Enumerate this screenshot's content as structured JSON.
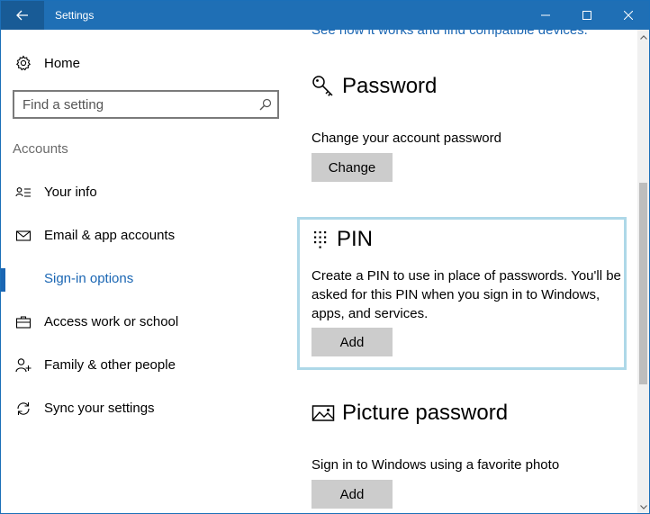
{
  "window": {
    "title": "Settings"
  },
  "sidebar": {
    "home_label": "Home",
    "search_placeholder": "Find a setting",
    "section_heading": "Accounts",
    "items": [
      {
        "label": "Your info",
        "icon": "person-card-icon"
      },
      {
        "label": "Email & app accounts",
        "icon": "mail-icon"
      },
      {
        "label": "Sign-in options",
        "icon": "key-icon",
        "active": true
      },
      {
        "label": "Access work or school",
        "icon": "briefcase-icon"
      },
      {
        "label": "Family & other people",
        "icon": "person-add-icon"
      },
      {
        "label": "Sync your settings",
        "icon": "sync-icon"
      }
    ]
  },
  "content": {
    "top_link": "See how it works and find compatible devices.",
    "password": {
      "title": "Password",
      "description": "Change your account password",
      "button": "Change"
    },
    "pin": {
      "title": "PIN",
      "description": "Create a PIN to use in place of passwords. You'll be asked for this PIN when you sign in to Windows, apps, and services.",
      "button": "Add"
    },
    "picture_password": {
      "title": "Picture password",
      "description": "Sign in to Windows using a favorite photo",
      "button": "Add"
    }
  },
  "colors": {
    "accent": "#1a66b3",
    "titlebar": "#1f6fb5",
    "focus_outline": "#aed8e8",
    "button_bg": "#cccccc"
  }
}
